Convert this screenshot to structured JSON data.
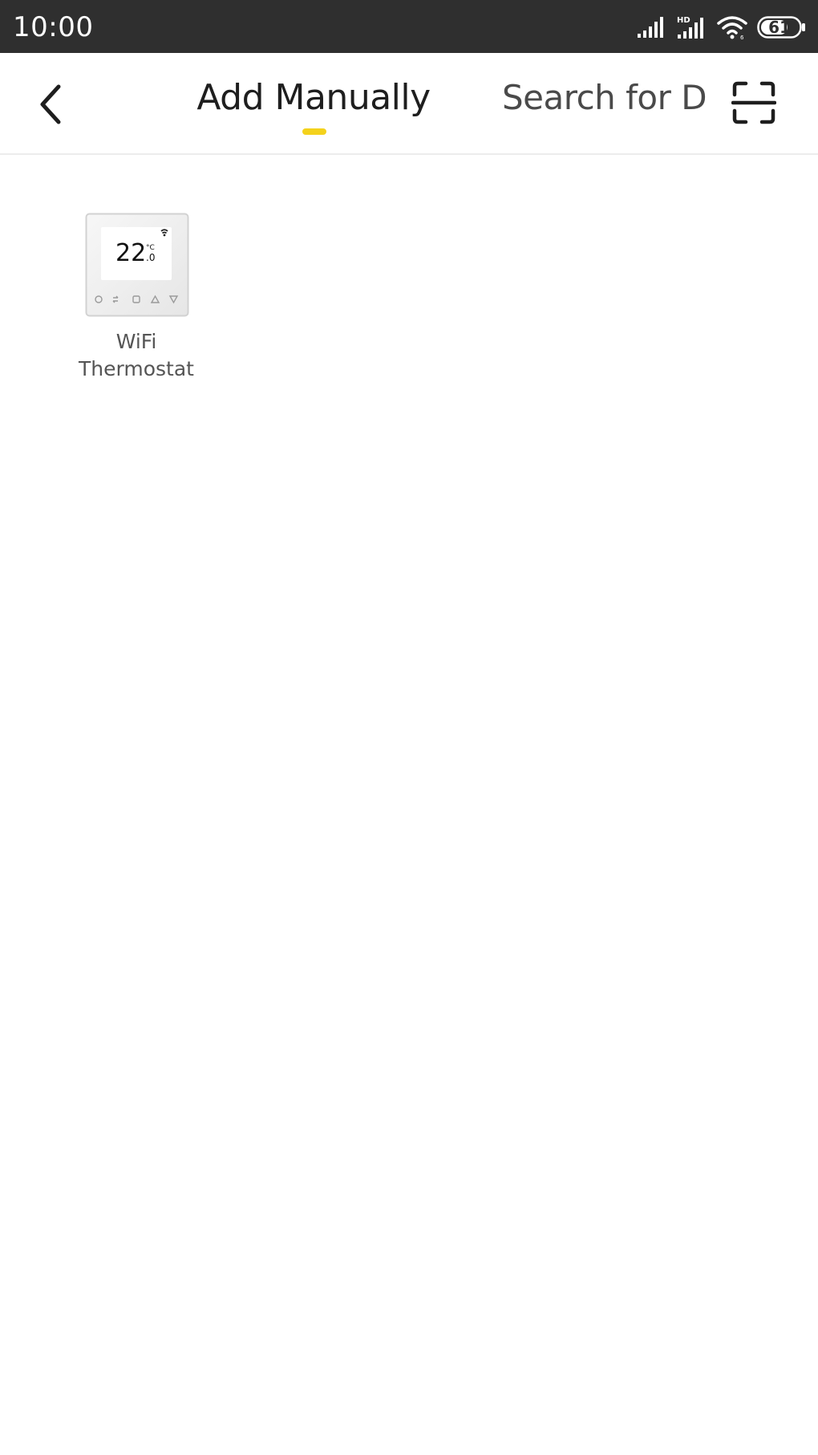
{
  "status_bar": {
    "time": "10:00",
    "battery_level": "61",
    "icons": [
      "signal-icon",
      "hd-signal-icon",
      "wifi-icon",
      "battery-icon"
    ],
    "background_color": "#2f2f2f"
  },
  "header": {
    "back_icon": "chevron-left-icon",
    "tabs": [
      {
        "label": "Add Manually",
        "active": true
      },
      {
        "label": "Search for D",
        "active": false
      }
    ],
    "scan_icon": "scan-frame-icon",
    "accent_color": "#f4d21c"
  },
  "devices": [
    {
      "name": "WiFi Thermostat",
      "display_value": "22",
      "display_unit": "°C",
      "display_decimal": ".0",
      "icon": "thermostat-icon"
    }
  ]
}
